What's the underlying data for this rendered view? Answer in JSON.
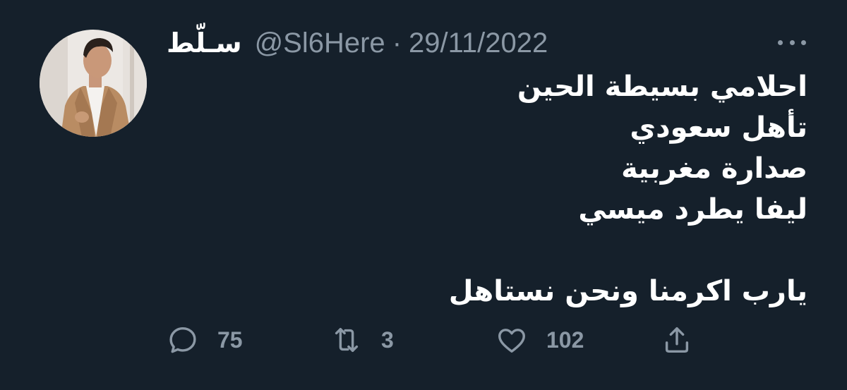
{
  "tweet": {
    "display_name": "سـلّط",
    "handle": "@Sl6Here",
    "separator": "·",
    "date": "29/11/2022",
    "lines": [
      "احلامي بسيطة الحين",
      "تأهل سعودي",
      "صدارة مغربية",
      "ليفا يطرد ميسي",
      "",
      "يارب اكرمنا ونحن نستاهل"
    ]
  },
  "actions": {
    "reply": {
      "icon": "reply-icon",
      "count": "75"
    },
    "retweet": {
      "icon": "retweet-icon",
      "count": "3"
    },
    "like": {
      "icon": "heart-icon",
      "count": "102"
    },
    "share": {
      "icon": "share-icon"
    }
  },
  "colors": {
    "background": "#15202b",
    "text": "#ffffff",
    "secondary": "#8b98a5"
  }
}
